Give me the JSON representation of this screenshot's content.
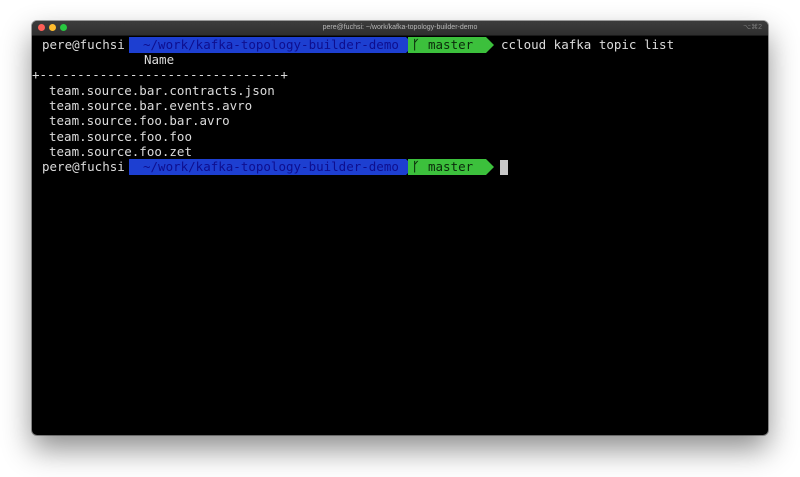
{
  "window": {
    "title": "pere@fuchsi: ~/work/kafka-topology-builder-demo",
    "shortcut": "⌥⌘2"
  },
  "prompt": {
    "user_host": "pere@fuchsi",
    "path": "~/work/kafka-topology-builder-demo",
    "branch_icon": "",
    "branch": "master"
  },
  "command": "ccloud kafka topic list",
  "output": {
    "header": "Name",
    "separator": "+--------------------------------+",
    "topics": [
      "team.source.bar.contracts.json",
      "team.source.bar.events.avro",
      "team.source.foo.bar.avro",
      "team.source.foo.foo",
      "team.source.foo.zet"
    ]
  },
  "colors": {
    "path_segment": "#1d3fd1",
    "git_segment": "#3cc03c",
    "background": "#000000"
  }
}
